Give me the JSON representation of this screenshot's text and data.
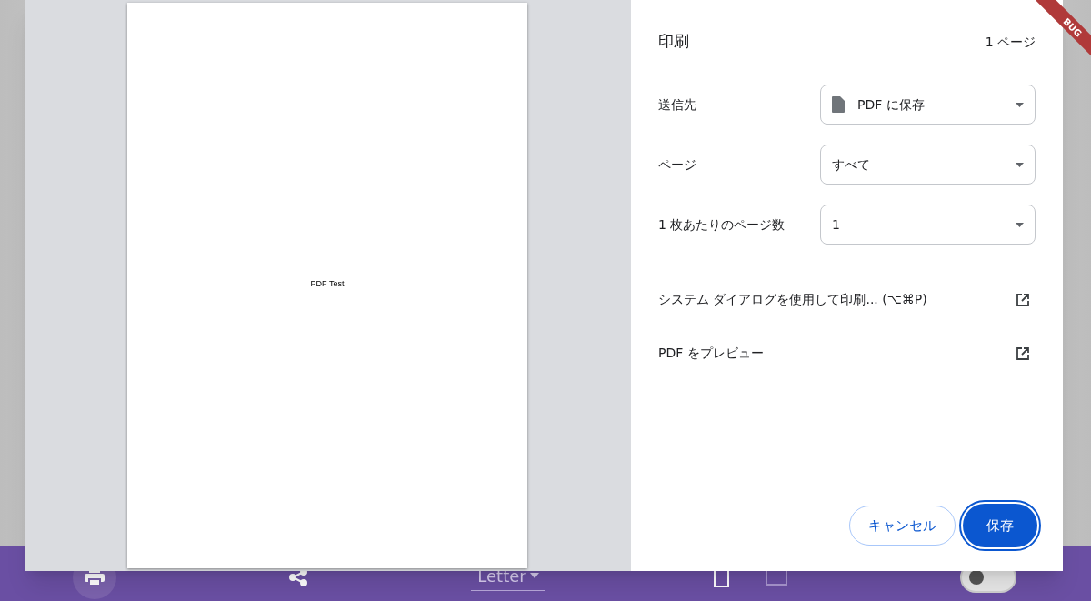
{
  "app_bar": {
    "paper": "Letter",
    "orientation": [
      {
        "kind": "portrait",
        "selected": true
      },
      {
        "kind": "landscape",
        "selected": false
      }
    ],
    "toggle": {
      "on": false
    }
  },
  "debug_banner": "BUG",
  "preview": {
    "text": "PDF Test"
  },
  "print_dialog": {
    "title": "印刷",
    "page_count": "1 ページ",
    "settings": [
      {
        "label": "送信先",
        "value": "PDF に保存",
        "kind": "file"
      },
      {
        "label": "ページ",
        "value": "すべて",
        "kind": "plain"
      },
      {
        "label": "1 枚あたりのページ数",
        "value": "1",
        "kind": "plain"
      }
    ],
    "links": [
      "システム ダイアログを使用して印刷... (⌥⌘P)",
      "PDF をプレビュー"
    ],
    "buttons": [
      {
        "label": "キャンセル",
        "kind": "secondary"
      },
      {
        "label": "保存",
        "kind": "primary"
      }
    ]
  }
}
